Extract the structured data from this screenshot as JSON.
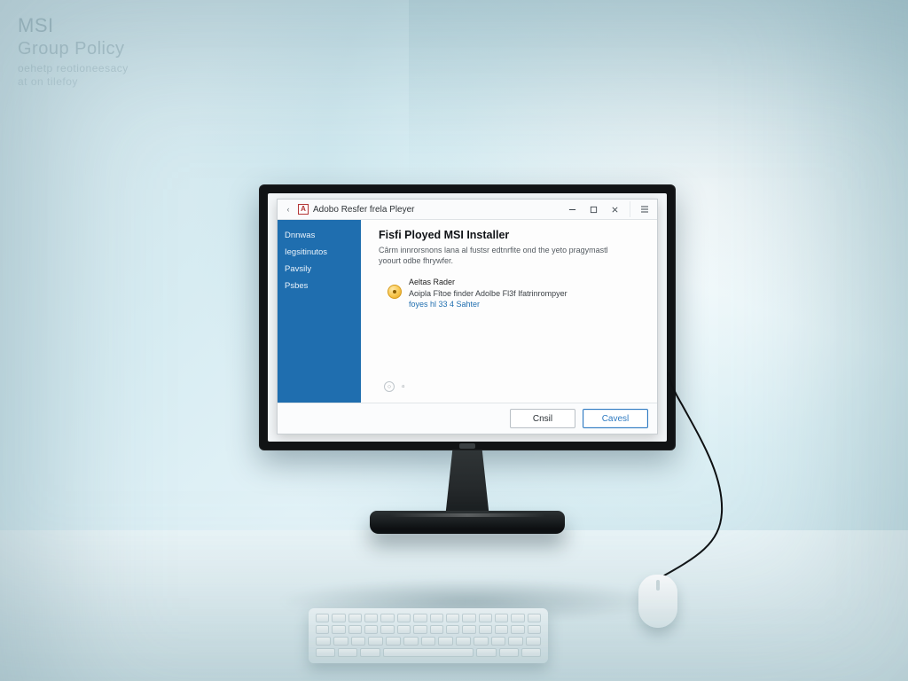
{
  "overlay": {
    "line1": "MSI",
    "line2": "Group Policy",
    "line3": "oehetp reotioneesacy",
    "line4": "at on tilefoy"
  },
  "window": {
    "title": "Adobo Resfer frela Pleyer",
    "controls": {
      "back_glyph": "‹"
    },
    "sidebar": {
      "items": [
        {
          "label": "Dnnwas"
        },
        {
          "label": "Iegsitinutos"
        },
        {
          "label": "Pavsily"
        },
        {
          "label": "Psbes"
        }
      ]
    },
    "content": {
      "heading": "Fisfi Ployed MSI Installer",
      "subtext": "Cârm innrorsnons lana al fustsr edtnrfite ond the yeto pragymastl yoourt odbe fhrywfer.",
      "item": {
        "title": "Aeltas Rader",
        "desc": "Aoipla Fîtoe finder Adolbe Fl3f Ifatrinrompyer",
        "link": "foyes hl 33 4 Sahter"
      },
      "pager": {
        "dot_glyph": "○",
        "square_glyph": "▫"
      }
    },
    "footer": {
      "cancel_label": "Cnsil",
      "ok_label": "Cavesl"
    }
  }
}
